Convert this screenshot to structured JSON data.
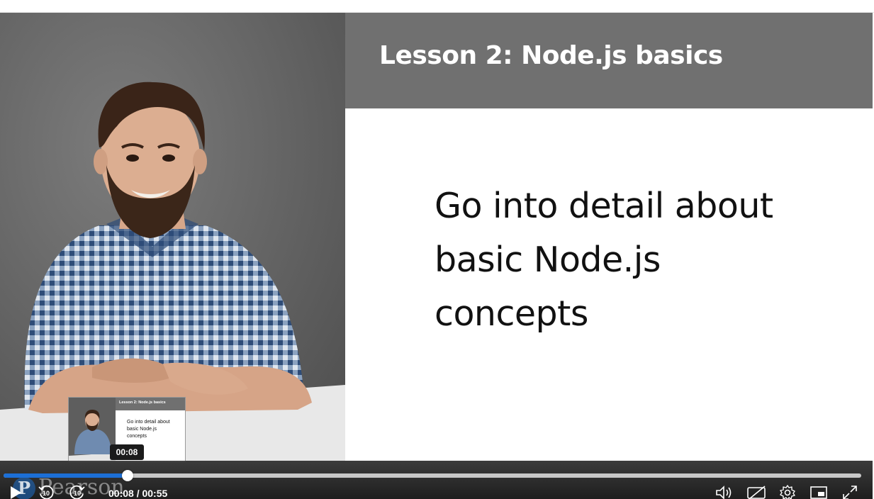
{
  "slide": {
    "title": "Lesson 2: Node.js basics",
    "body_lines": [
      "Go into detail about",
      "basic Node.js",
      "concepts"
    ]
  },
  "thumbnail": {
    "title": "Lesson 2: Node.js basics",
    "body_lines": [
      "Go into detail about",
      "basic Node.js",
      "concepts"
    ],
    "hover_time": "00:08"
  },
  "player": {
    "current_time": "00:08",
    "duration": "00:55",
    "time_display": "00:08 / 00:55",
    "progress_fraction": 0.145,
    "skip_back_label": "10",
    "skip_forward_label": "10",
    "watermark": "Pearson",
    "accent_color": "#1c6fd6"
  },
  "icons": {
    "play": "play-icon",
    "rewind": "rewind-10-icon",
    "forward": "forward-10-icon",
    "volume": "volume-icon",
    "captions": "captions-off-icon",
    "settings": "gear-icon",
    "pip": "picture-in-picture-icon",
    "fullscreen": "fullscreen-icon"
  }
}
